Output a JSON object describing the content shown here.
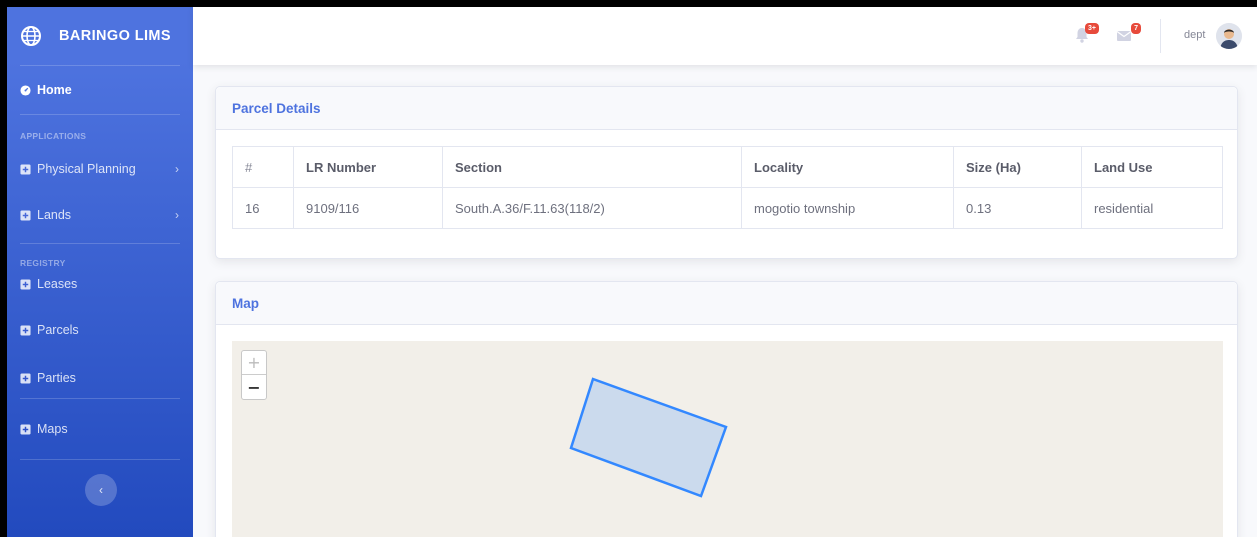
{
  "app": {
    "brand": "BARINGO LIMS"
  },
  "sidebar": {
    "home": "Home",
    "headings": [
      "APPLICATIONS",
      "REGISTRY"
    ],
    "applications": [
      {
        "label": "Physical Planning"
      },
      {
        "label": "Lands"
      }
    ],
    "registry": [
      {
        "label": "Leases"
      },
      {
        "label": "Parcels"
      },
      {
        "label": "Parties"
      }
    ],
    "maps": "Maps"
  },
  "topbar": {
    "alerts_badge": "3+",
    "messages_badge": "7",
    "user": "dept"
  },
  "parcel_details": {
    "title": "Parcel Details",
    "columns": [
      "#",
      "LR Number",
      "Section",
      "Locality",
      "Size (Ha)",
      "Land Use"
    ],
    "rows": [
      [
        "16",
        "9109/116",
        "South.A.36/F.11.63(118/2)",
        "mogotio township",
        "0.13",
        "residential"
      ]
    ]
  },
  "map": {
    "title": "Map",
    "zoom_in": "+",
    "zoom_out": "−"
  },
  "colors": {
    "primary": "#4e73df",
    "danger": "#e74a3b",
    "map_bg": "#f2efe9",
    "parcel_stroke": "#3388ff"
  }
}
